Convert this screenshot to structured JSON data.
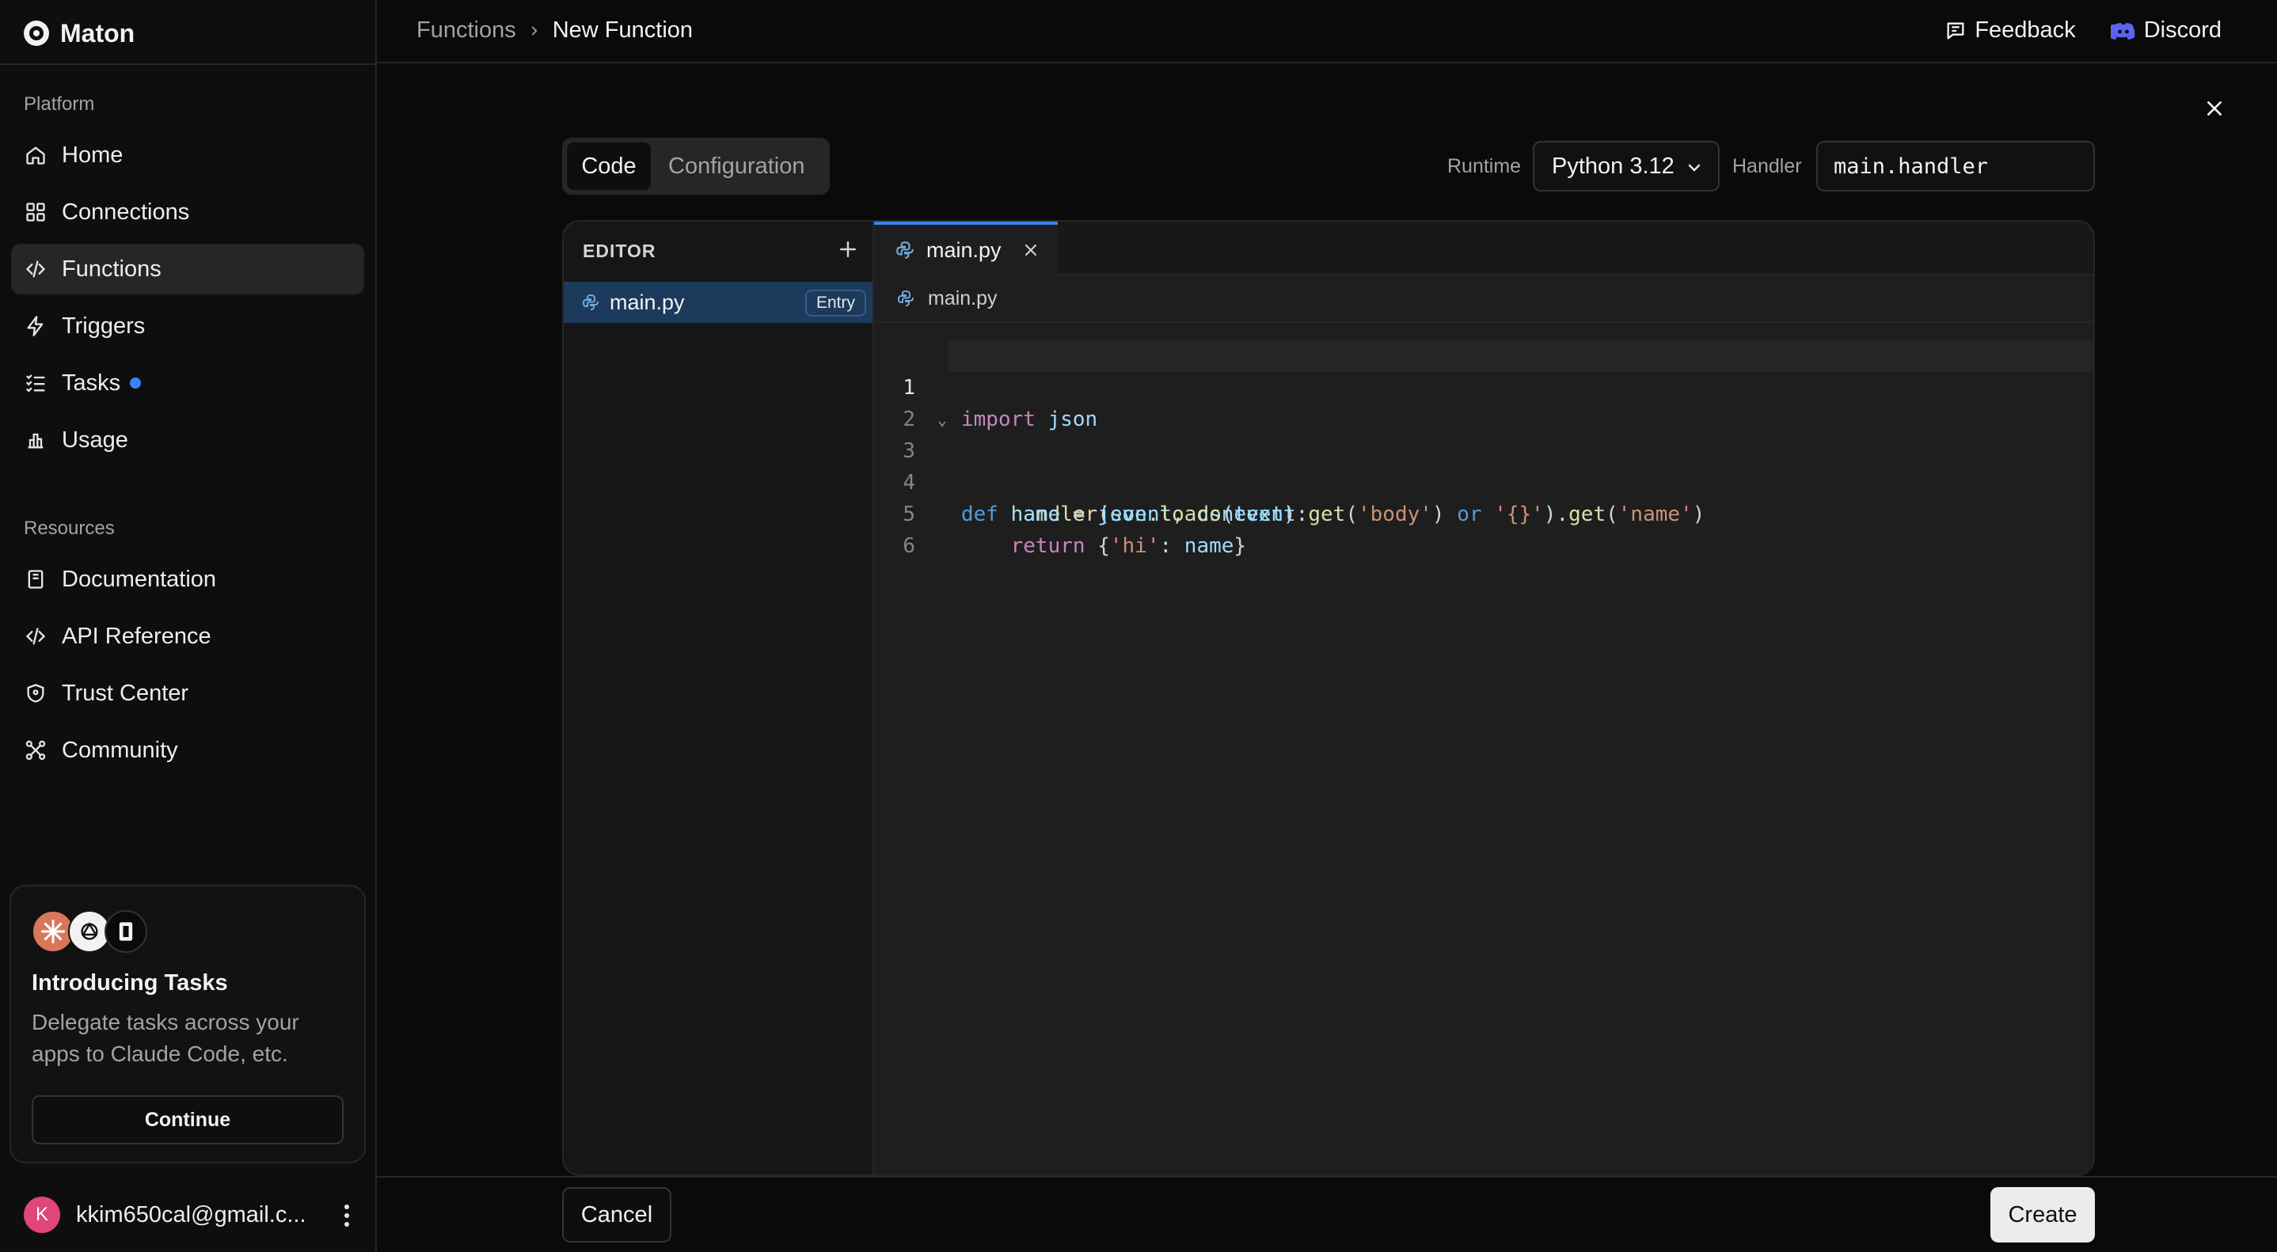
{
  "app": {
    "name": "Maton"
  },
  "sidebar": {
    "platform_label": "Platform",
    "platform_items": [
      {
        "label": "Home",
        "icon": "home-icon"
      },
      {
        "label": "Connections",
        "icon": "grid-icon"
      },
      {
        "label": "Functions",
        "icon": "code-icon",
        "active": true
      },
      {
        "label": "Triggers",
        "icon": "bolt-icon"
      },
      {
        "label": "Tasks",
        "icon": "list-check-icon",
        "badge_dot": true
      },
      {
        "label": "Usage",
        "icon": "bar-chart-icon"
      }
    ],
    "resources_label": "Resources",
    "resource_items": [
      {
        "label": "Documentation",
        "icon": "book-icon"
      },
      {
        "label": "API Reference",
        "icon": "code-icon"
      },
      {
        "label": "Trust Center",
        "icon": "shield-icon"
      },
      {
        "label": "Community",
        "icon": "community-icon"
      }
    ],
    "promo": {
      "title": "Introducing Tasks",
      "description": "Delegate tasks across your apps to Claude Code, etc.",
      "button": "Continue"
    },
    "account": {
      "initial": "K",
      "email": "kkim650cal@gmail.c..."
    }
  },
  "header": {
    "breadcrumb": [
      "Functions",
      "New Function"
    ],
    "links": {
      "feedback": "Feedback",
      "discord": "Discord"
    }
  },
  "tabs": {
    "code": "Code",
    "configuration": "Configuration",
    "active": "Code"
  },
  "runtime": {
    "label": "Runtime",
    "value": "Python 3.12"
  },
  "handler": {
    "label": "Handler",
    "value": "main.handler"
  },
  "editor": {
    "header": "EDITOR",
    "files": [
      {
        "name": "main.py",
        "badge": "Entry"
      }
    ],
    "open_tab": "main.py",
    "breadcrumb": "main.py",
    "line_numbers": [
      "1",
      "2",
      "3",
      "4",
      "5",
      "6"
    ],
    "current_line": 1,
    "code_lines": [
      "import json",
      "",
      "def handler(event, context):",
      "    name = json.loads(event.get('body') or '{}').get('name')",
      "    return {'hi': name}",
      ""
    ]
  },
  "footer": {
    "cancel": "Cancel",
    "create": "Create"
  },
  "colors": {
    "accent": "#3b82f6",
    "selection": "#1b3a5c",
    "avatar": "#e0457b"
  }
}
